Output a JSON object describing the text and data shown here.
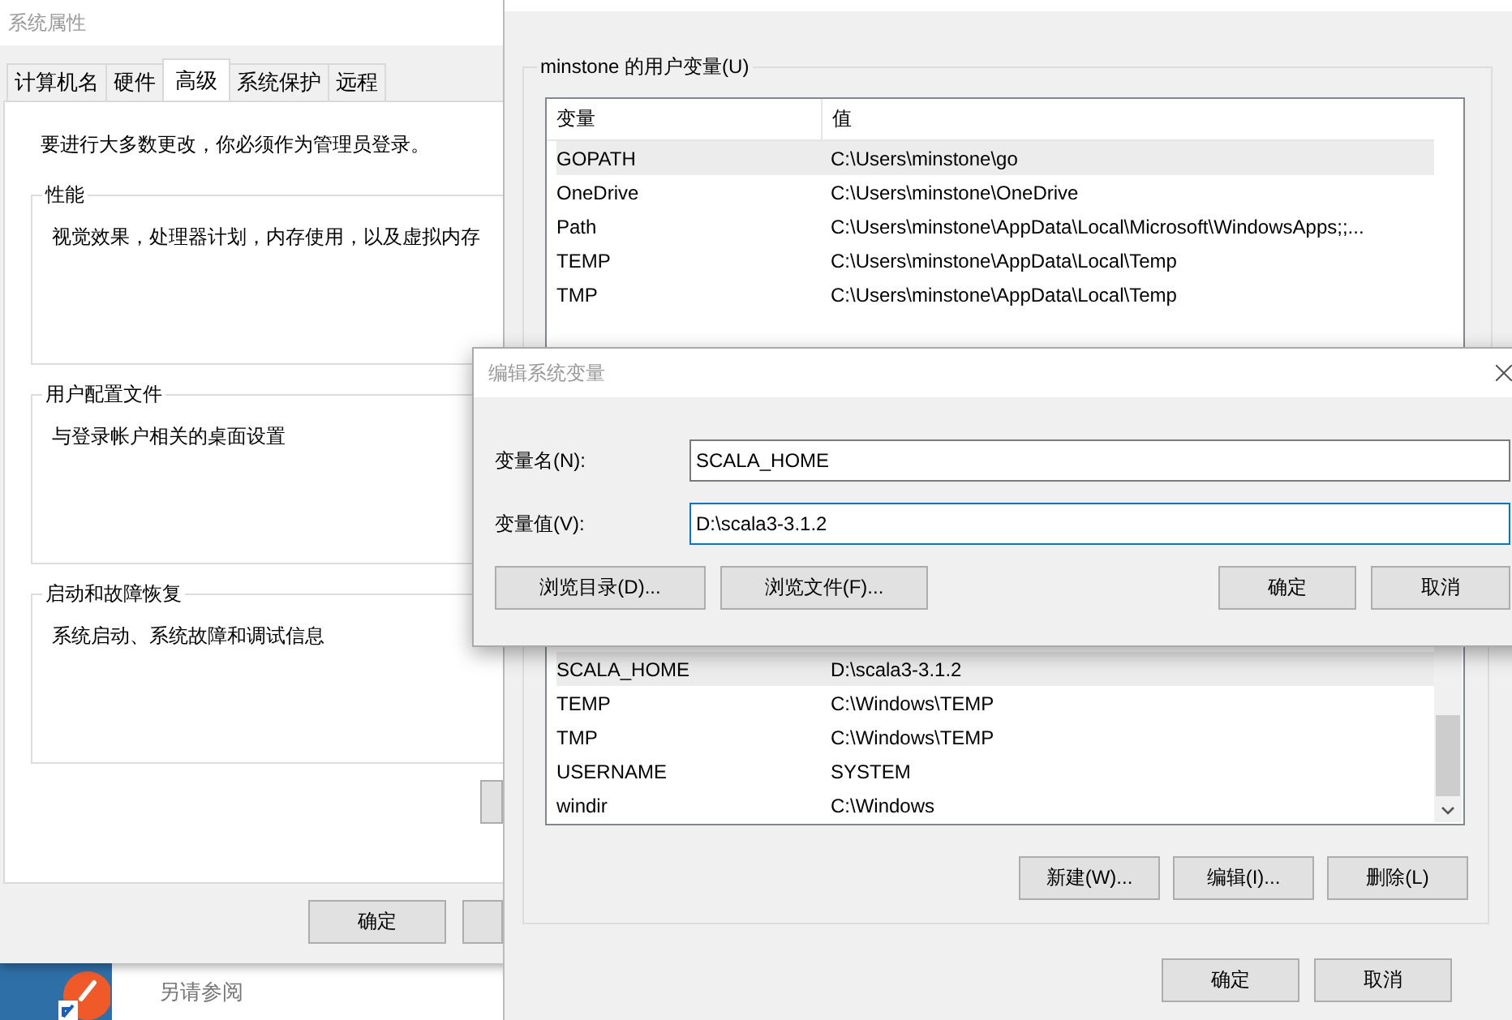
{
  "background_window": {
    "text": "另请参阅"
  },
  "system_properties": {
    "title": "系统属性",
    "tabs": [
      {
        "label": "计算机名",
        "selected": false
      },
      {
        "label": "硬件",
        "selected": false
      },
      {
        "label": "高级",
        "selected": true
      },
      {
        "label": "系统保护",
        "selected": false
      },
      {
        "label": "远程",
        "selected": false
      }
    ],
    "notice": "要进行大多数更改，你必须作为管理员登录。",
    "groups": [
      {
        "title": "性能",
        "description": "视觉效果，处理器计划，内存使用，以及虚拟内存"
      },
      {
        "title": "用户配置文件",
        "description": "与登录帐户相关的桌面设置"
      },
      {
        "title": "启动和故障恢复",
        "description": "系统启动、系统故障和调试信息"
      }
    ],
    "buttons": [
      "确定"
    ]
  },
  "environment_variables": {
    "user_group": {
      "title": "minstone 的用户变量(U)",
      "columns": [
        "变量",
        "值"
      ],
      "rows": [
        {
          "name": "GOPATH",
          "value": "C:\\Users\\minstone\\go",
          "selected": true
        },
        {
          "name": "OneDrive",
          "value": "C:\\Users\\minstone\\OneDrive",
          "selected": false
        },
        {
          "name": "Path",
          "value": "C:\\Users\\minstone\\AppData\\Local\\Microsoft\\WindowsApps;;...",
          "selected": false
        },
        {
          "name": "TEMP",
          "value": "C:\\Users\\minstone\\AppData\\Local\\Temp",
          "selected": false
        },
        {
          "name": "TMP",
          "value": "C:\\Users\\minstone\\AppData\\Local\\Temp",
          "selected": false
        }
      ]
    },
    "system_rows": [
      {
        "name": "SCALA_HOME",
        "value": "D:\\scala3-3.1.2",
        "selected": true
      },
      {
        "name": "TEMP",
        "value": "C:\\Windows\\TEMP",
        "selected": false
      },
      {
        "name": "TMP",
        "value": "C:\\Windows\\TEMP",
        "selected": false
      },
      {
        "name": "USERNAME",
        "value": "SYSTEM",
        "selected": false
      },
      {
        "name": "windir",
        "value": "C:\\Windows",
        "selected": false
      }
    ],
    "list_buttons": [
      "新建(W)...",
      "编辑(I)...",
      "删除(L)"
    ],
    "buttons": [
      "确定",
      "取消"
    ]
  },
  "edit_dialog": {
    "title": "编辑系统变量",
    "fields": [
      {
        "label": "变量名(N):",
        "value": "SCALA_HOME",
        "focused": false
      },
      {
        "label": "变量值(V):",
        "value": "D:\\scala3-3.1.2",
        "focused": true
      }
    ],
    "browse_buttons": [
      "浏览目录(D)...",
      "浏览文件(F)..."
    ],
    "buttons": [
      "确定",
      "取消"
    ]
  }
}
